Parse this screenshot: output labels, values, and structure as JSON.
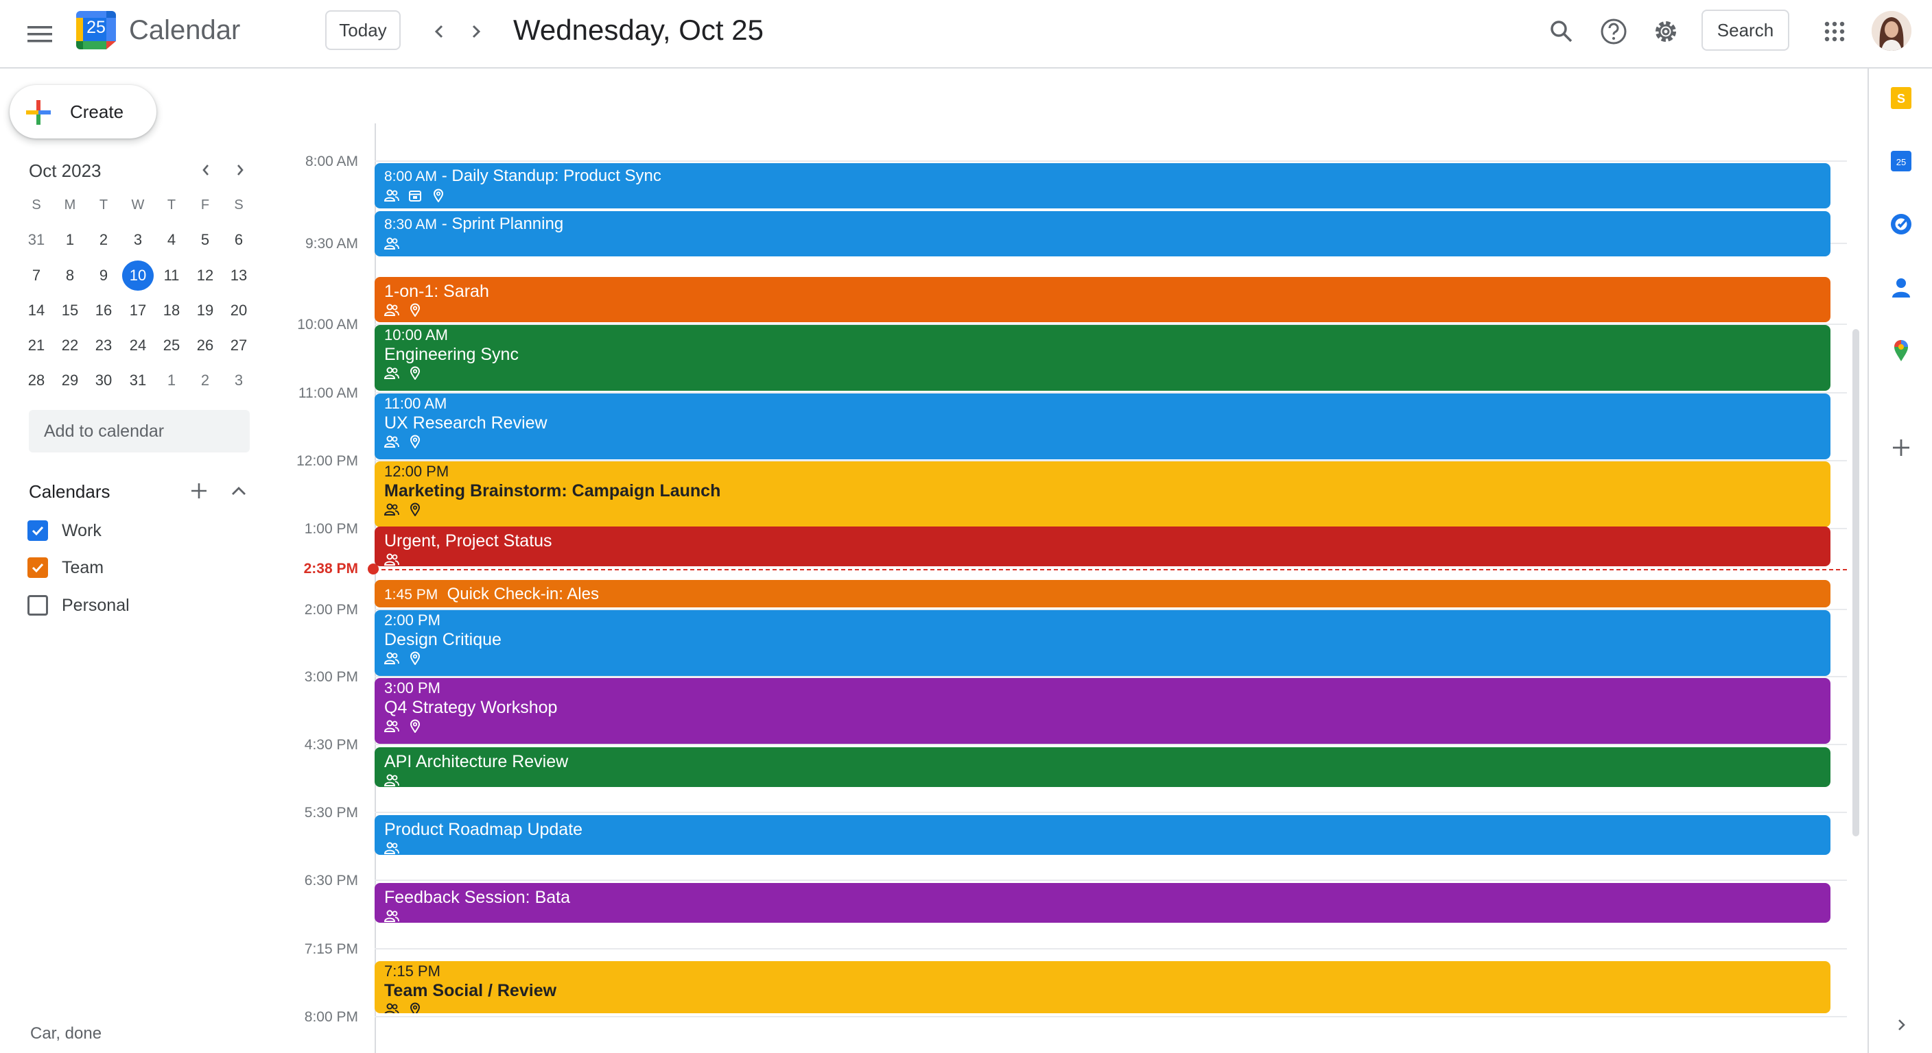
{
  "app": {
    "name": "Calendar",
    "logo_day": "25"
  },
  "header": {
    "today_label": "Today",
    "date_title": "Wednesday, Oct 25",
    "search_label": "Search"
  },
  "sidebar": {
    "create_label": "Create",
    "mini_calendar": {
      "month_title": "Oct 2023",
      "weekdays": [
        "S",
        "M",
        "T",
        "W",
        "T",
        "F",
        "S"
      ],
      "weeks": [
        [
          "31",
          "1",
          "2",
          "3",
          "4",
          "5",
          "6"
        ],
        [
          "7",
          "8",
          "9",
          "10",
          "11",
          "12",
          "13"
        ],
        [
          "14",
          "15",
          "16",
          "17",
          "18",
          "19",
          "20"
        ],
        [
          "21",
          "22",
          "23",
          "24",
          "25",
          "26",
          "27"
        ],
        [
          "28",
          "29",
          "30",
          "31",
          "1",
          "2",
          "3"
        ]
      ],
      "selected_day": "10"
    },
    "add_calendar_placeholder": "Add to calendar",
    "calendars_heading": "Calendars",
    "calendars": [
      {
        "label": "Work",
        "checked": true,
        "color": "#1a73e8"
      },
      {
        "label": "Team",
        "checked": true,
        "color": "#e8710a"
      },
      {
        "label": "Personal",
        "checked": false,
        "color": "#5f6368"
      }
    ],
    "footer_text": "Car, done"
  },
  "time_labels": [
    "8:00 AM",
    "9:30 AM",
    "10:00 AM",
    "11:00 AM",
    "12:00 PM",
    "1:00 PM",
    "2:38 PM",
    "2:00 PM",
    "3:00 PM",
    "4:30 PM",
    "5:30 PM",
    "6:30 PM",
    "7:15 PM",
    "8:00 PM"
  ],
  "current_time_label": "2:38 PM",
  "events": [
    {
      "time": "8:00 AM",
      "title": "Daily Standup: Product Sync",
      "color": "#1a8ee0",
      "icons": [
        "people-icon",
        "calendar-small-icon",
        "location-icon"
      ]
    },
    {
      "time": "8:30 AM",
      "title": "Sprint Planning",
      "color": "#1a8ee0",
      "icons": [
        "people-icon"
      ]
    },
    {
      "time": "",
      "title": "1-on-1: Sarah",
      "color": "#e8630a",
      "icons": [
        "people-icon",
        "location-icon"
      ]
    },
    {
      "time": "10:00 AM",
      "title": "Engineering Sync",
      "color": "#188038",
      "icons": [
        "people-icon",
        "location-icon"
      ]
    },
    {
      "time": "11:00 AM",
      "title": "UX Research Review",
      "color": "#1a8ee0",
      "icons": [
        "people-icon",
        "location-icon"
      ]
    },
    {
      "time": "12:00 PM",
      "title": "Marketing Brainstorm: Campaign Launch",
      "color": "#f9b90d",
      "icons": [
        "people-icon",
        "location-icon"
      ]
    },
    {
      "time": "",
      "title": "Urgent, Project Status",
      "color": "#c5221f",
      "icons": [
        "people-icon"
      ]
    },
    {
      "time": "1:45 PM",
      "title": "Quick Check-in: Ales",
      "color": "#e8710a",
      "icons": []
    },
    {
      "time": "2:00 PM",
      "title": "Design Critique",
      "color": "#1a8ee0",
      "icons": [
        "people-icon",
        "location-icon"
      ]
    },
    {
      "time": "3:00 PM",
      "title": "Q4 Strategy Workshop",
      "color": "#8e24aa",
      "icons": [
        "people-icon",
        "location-icon"
      ]
    },
    {
      "time": "",
      "title": "API Architecture Review",
      "color": "#188038",
      "icons": [
        "people-icon"
      ]
    },
    {
      "time": "",
      "title": "Product Roadmap Update",
      "color": "#1a8ee0",
      "icons": [
        "people-icon"
      ]
    },
    {
      "time": "",
      "title": "Feedback Session: Bata",
      "color": "#8e24aa",
      "icons": [
        "people-icon"
      ]
    },
    {
      "time": "7:15 PM",
      "title": "Team Social / Review",
      "color": "#f9b90d",
      "icons": [
        "people-icon",
        "location-icon"
      ]
    }
  ],
  "right_rail": [
    "keep-icon",
    "calendar-addon-icon",
    "tasks-icon",
    "contacts-icon",
    "maps-icon",
    "add-addon-icon",
    "expand-panel-icon"
  ]
}
